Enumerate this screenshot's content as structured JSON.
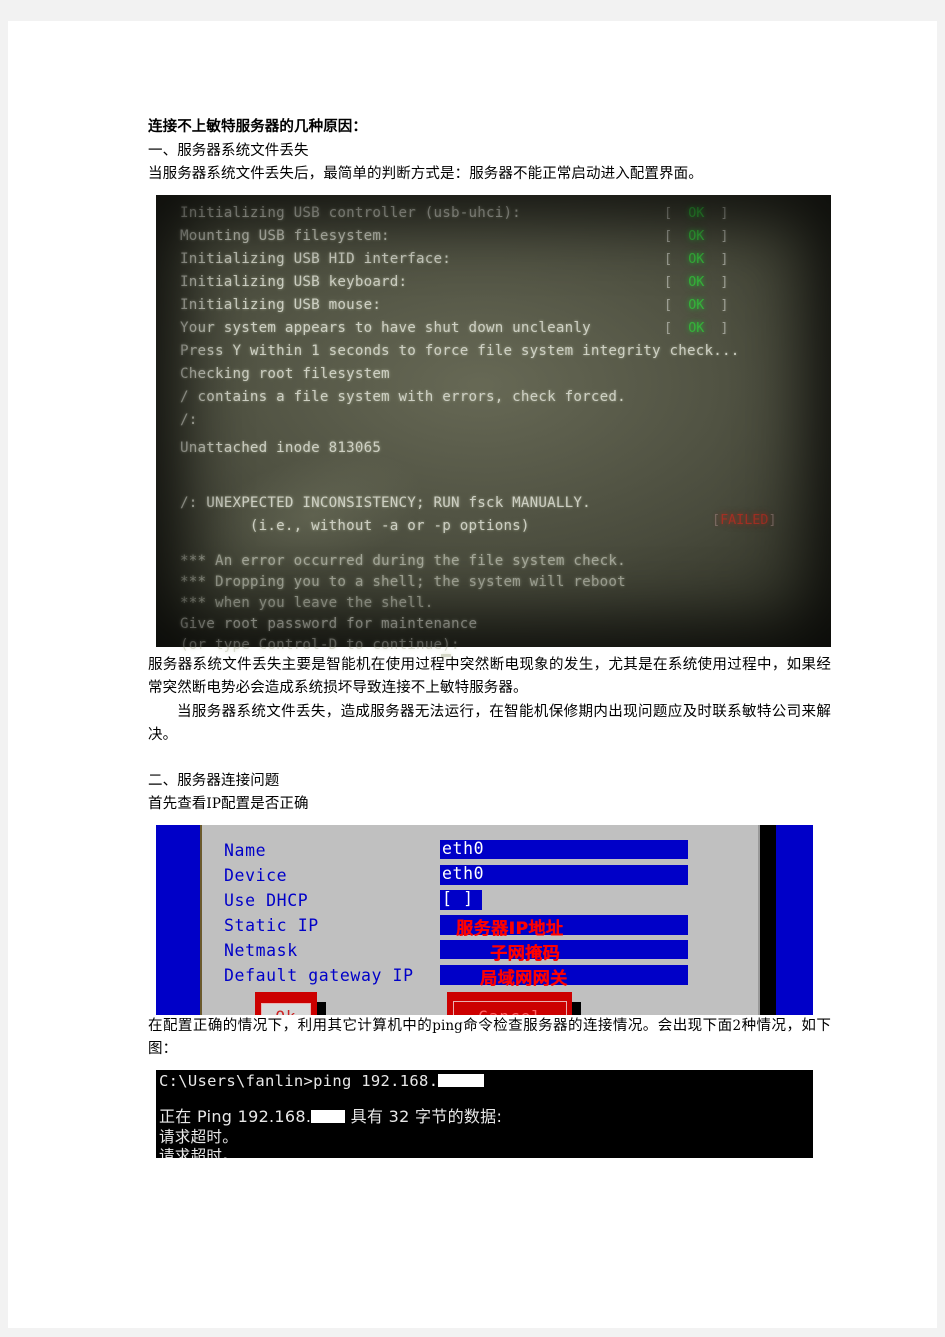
{
  "document": {
    "heading": "连接不上敏特服务器的几种原因：",
    "section1": {
      "title": "一、服务器系统文件丢失",
      "lead": "当服务器系统文件丢失后，最简单的判断方式是：服务器不能正常启动进入配置界面。",
      "para1": "服务器系统文件丢失主要是智能机在使用过程中突然断电现象的发生，尤其是在系统使用过程中，如果经常突然断电势必会造成系统损坏导致连接不上敏特服务器。",
      "para2": "当服务器系统文件丢失，造成服务器无法运行，在智能机保修期内出现问题应及时联系敏特公司来解决。"
    },
    "section2": {
      "title": "二、服务器连接问题",
      "lead_a": "首先查看",
      "lead_code": "IP",
      "lead_b": "配置是否正确",
      "after_a": "在配置正确的情况下，利用其它计算机中的",
      "after_code": "ping",
      "after_b": "命令检查服务器的连接情况。会出现下面",
      "after_num": "2",
      "after_c": "种情况，如下图："
    }
  },
  "figure_boot": {
    "lines": [
      "Initializing USB controller (usb-uhci):",
      "Mounting USB filesystem:",
      "Initializing USB HID interface:",
      "Initializing USB keyboard:",
      "Initializing USB mouse:",
      "Your system appears to have shut down uncleanly",
      "Press Y within 1 seconds to force file system integrity check...",
      "Checking root filesystem",
      "/ contains a file system with errors, check forced.",
      "/:",
      "Unattached inode 813065",
      "/: UNEXPECTED INCONSISTENCY; RUN fsck MANUALLY.",
      "        (i.e., without -a or -p options)",
      "*** An error occurred during the file system check.",
      "*** Dropping you to a shell; the system will reboot",
      "*** when you leave the shell.",
      "Give root password for maintenance",
      "(or type Control-D to continue): "
    ],
    "ok_label": "OK",
    "ok_bracket_left": "[",
    "ok_bracket_right": "]",
    "ok_count": 6,
    "failed_label": "FAILED",
    "failed_bracket_left": "[",
    "failed_bracket_right": "]",
    "colors": {
      "ok": "#35b23a",
      "failed": "#a33024",
      "text": "#d7d9cd",
      "screen": "#4b4d40"
    }
  },
  "figure_net": {
    "rows": [
      {
        "label": "Name",
        "value": "eth0",
        "annot": ""
      },
      {
        "label": "Device",
        "value": "eth0",
        "annot": ""
      },
      {
        "label": "Use DHCP",
        "value": "[ ]",
        "annot": ""
      },
      {
        "label": "Static IP",
        "value": "",
        "annot": "服务器IP地址"
      },
      {
        "label": "Netmask",
        "value": "",
        "annot": "子网掩码"
      },
      {
        "label": "Default gateway IP",
        "value": "",
        "annot": "局域网网关"
      }
    ],
    "ok_button": "Ok",
    "cancel_button": "Cancel",
    "colors": {
      "backdrop": "#0000c8",
      "dialog": "#c0c0c0",
      "field": "#0000c8",
      "annot": "#ff0000",
      "button": "#cc0000"
    }
  },
  "figure_cmd": {
    "prompt_line": "C:\\Users\\fanlin>ping 192.168.",
    "ping_line_a": "正在 Ping 192.168.",
    "ping_line_b": " 具有 32 字节的数据:",
    "timeout_line_1": "请求超时。",
    "timeout_line_2": "请求超时。",
    "redacted": "████"
  }
}
